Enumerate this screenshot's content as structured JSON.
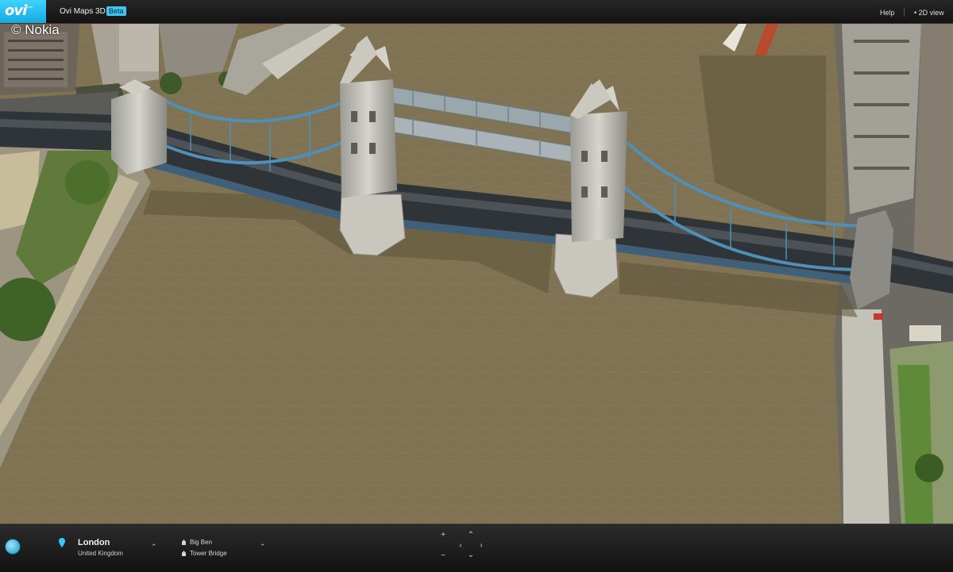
{
  "topbar": {
    "logo_text": "ovi",
    "logo_sub": "beta",
    "app_title": "Ovi Maps 3D",
    "beta_badge": "Beta",
    "help_label": "Help",
    "view_2d_label": "2D view"
  },
  "location": {
    "city": "London",
    "country": "United Kingdom"
  },
  "poi_list": [
    {
      "label": "Big Ben"
    },
    {
      "label": "Tower Bridge"
    }
  ],
  "watermark": "© Nokia",
  "colors": {
    "accent": "#3ec7f3",
    "bar_bg": "#1a1a1a",
    "river": "#7f7353",
    "bridge_cables": "#4f8fb8"
  },
  "icons": {
    "pin": "location-pin-icon",
    "poi": "landmark-icon",
    "globe": "globe-icon",
    "person": "street-view-person-icon"
  }
}
